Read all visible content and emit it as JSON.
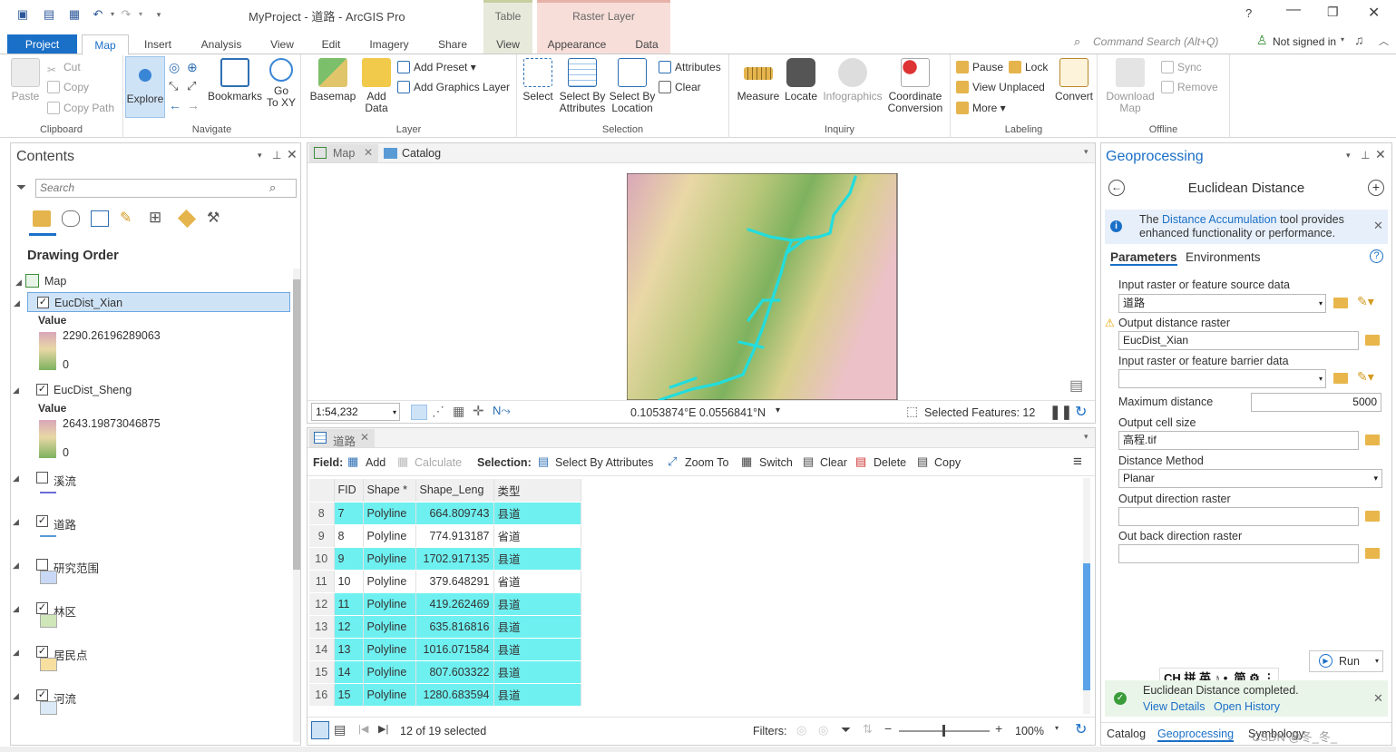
{
  "window": {
    "title": "MyProject - 道路 - ArcGIS Pro",
    "help": "?"
  },
  "context_tabs": {
    "table_group": "Table",
    "raster_group": "Raster Layer",
    "view_tab": "View",
    "appearance_tab": "Appearance",
    "data_tab": "Data"
  },
  "tabs": [
    "Project",
    "Map",
    "Insert",
    "Analysis",
    "View",
    "Edit",
    "Imagery",
    "Share"
  ],
  "command_search": {
    "placeholder": "Command Search (Alt+Q)"
  },
  "user": {
    "status": "Not signed in"
  },
  "ribbon": {
    "clipboard": {
      "label": "Clipboard",
      "paste": "Paste",
      "cut": "Cut",
      "copy": "Copy",
      "copy_path": "Copy Path"
    },
    "navigate": {
      "label": "Navigate",
      "explore": "Explore",
      "bookmarks": "Bookmarks",
      "go_to_xy": "Go To XY",
      "go_to_line1": "Go",
      "go_to_line2": "To XY"
    },
    "layer": {
      "label": "Layer",
      "basemap": "Basemap",
      "add_data_1": "Add",
      "add_data_2": "Data",
      "add_preset": "Add Preset",
      "add_graphics": "Add Graphics Layer"
    },
    "selection": {
      "label": "Selection",
      "select": "Select",
      "by_attr_1": "Select By",
      "by_attr_2": "Attributes",
      "by_loc_1": "Select By",
      "by_loc_2": "Location",
      "attributes": "Attributes",
      "clear": "Clear"
    },
    "inquiry": {
      "label": "Inquiry",
      "measure": "Measure",
      "locate": "Locate",
      "infographics": "Infographics",
      "coord_1": "Coordinate",
      "coord_2": "Conversion"
    },
    "labeling": {
      "label": "Labeling",
      "pause": "Pause",
      "lock": "Lock",
      "view_unplaced": "View Unplaced",
      "more": "More",
      "convert": "Convert"
    },
    "offline": {
      "label": "Offline",
      "download_1": "Download",
      "download_2": "Map",
      "sync": "Sync",
      "remove": "Remove"
    }
  },
  "contents": {
    "title": "Contents",
    "search_placeholder": "Search",
    "drawing_order": "Drawing Order",
    "map_label": "Map",
    "layers": [
      {
        "name": "EucDist_Xian",
        "checked": true,
        "value_label": "Value",
        "max": "2290.26196289063",
        "min": "0"
      },
      {
        "name": "EucDist_Sheng",
        "checked": true,
        "value_label": "Value",
        "max": "2643.19873046875",
        "min": "0"
      },
      {
        "name": "溪流",
        "checked": false
      },
      {
        "name": "道路",
        "checked": true
      },
      {
        "name": "研究范围",
        "checked": false
      },
      {
        "name": "林区",
        "checked": true
      },
      {
        "name": "居民点",
        "checked": true
      },
      {
        "name": "河流",
        "checked": true
      }
    ]
  },
  "mapview": {
    "tab_map": "Map",
    "tab_catalog": "Catalog",
    "scale": "1:54,232",
    "coords": "0.1053874°E 0.0556841°N",
    "selected_features": "Selected Features: 12"
  },
  "table": {
    "tab": "道路",
    "field_label": "Field:",
    "add": "Add",
    "calculate": "Calculate",
    "selection_label": "Selection:",
    "select_by_attr": "Select By Attributes",
    "zoom_to": "Zoom To",
    "switch": "Switch",
    "clear": "Clear",
    "delete": "Delete",
    "copy": "Copy",
    "columns": [
      "FID",
      "Shape *",
      "Shape_Leng",
      "类型"
    ],
    "rows": [
      {
        "n": "8",
        "fid": "7",
        "shape": "Polyline",
        "len": "664.809743",
        "type": "县道",
        "sel": true
      },
      {
        "n": "9",
        "fid": "8",
        "shape": "Polyline",
        "len": "774.913187",
        "type": "省道",
        "sel": false
      },
      {
        "n": "10",
        "fid": "9",
        "shape": "Polyline",
        "len": "1702.917135",
        "type": "县道",
        "sel": true
      },
      {
        "n": "11",
        "fid": "10",
        "shape": "Polyline",
        "len": "379.648291",
        "type": "省道",
        "sel": false
      },
      {
        "n": "12",
        "fid": "11",
        "shape": "Polyline",
        "len": "419.262469",
        "type": "县道",
        "sel": true
      },
      {
        "n": "13",
        "fid": "12",
        "shape": "Polyline",
        "len": "635.816816",
        "type": "县道",
        "sel": true
      },
      {
        "n": "14",
        "fid": "13",
        "shape": "Polyline",
        "len": "1016.071584",
        "type": "县道",
        "sel": true
      },
      {
        "n": "15",
        "fid": "14",
        "shape": "Polyline",
        "len": "807.603322",
        "type": "县道",
        "sel": true
      },
      {
        "n": "16",
        "fid": "15",
        "shape": "Polyline",
        "len": "1280.683594",
        "type": "县道",
        "sel": true
      }
    ],
    "status": "12 of 19 selected",
    "filters": "Filters:",
    "zoom": "100%"
  },
  "geoprocessing": {
    "title": "Geoprocessing",
    "tool": "Euclidean Distance",
    "info_pre": "The ",
    "info_link": "Distance Accumulation",
    "info_post": " tool provides enhanced functionality or performance.",
    "tab_params": "Parameters",
    "tab_env": "Environments",
    "p_input_label": "Input raster or feature source data",
    "p_input_val": "道路",
    "p_output_label": "Output distance raster",
    "p_output_val": "EucDist_Xian",
    "p_barrier_label": "Input raster or feature barrier data",
    "p_barrier_val": "",
    "p_maxdist_label": "Maximum distance",
    "p_maxdist_val": "5000",
    "p_cell_label": "Output cell size",
    "p_cell_val": "高程.tif",
    "p_method_label": "Distance Method",
    "p_method_val": "Planar",
    "p_dir_label": "Output direction raster",
    "p_back_label": "Out back direction raster",
    "run": "Run",
    "ime": "CH 拼 英 ♪ •, 简 ⚙ ⋮",
    "done_msg": "Euclidean Distance completed.",
    "view_details": "View Details",
    "open_history": "Open History",
    "bottom_catalog": "Catalog",
    "bottom_geo": "Geoprocessing",
    "bottom_symbology": "Symbology",
    "watermark": "CSDN @冬_冬_"
  },
  "colors": {
    "accent": "#1a6fc7",
    "selection": "#6ff0f0",
    "road": "#22dddd"
  }
}
